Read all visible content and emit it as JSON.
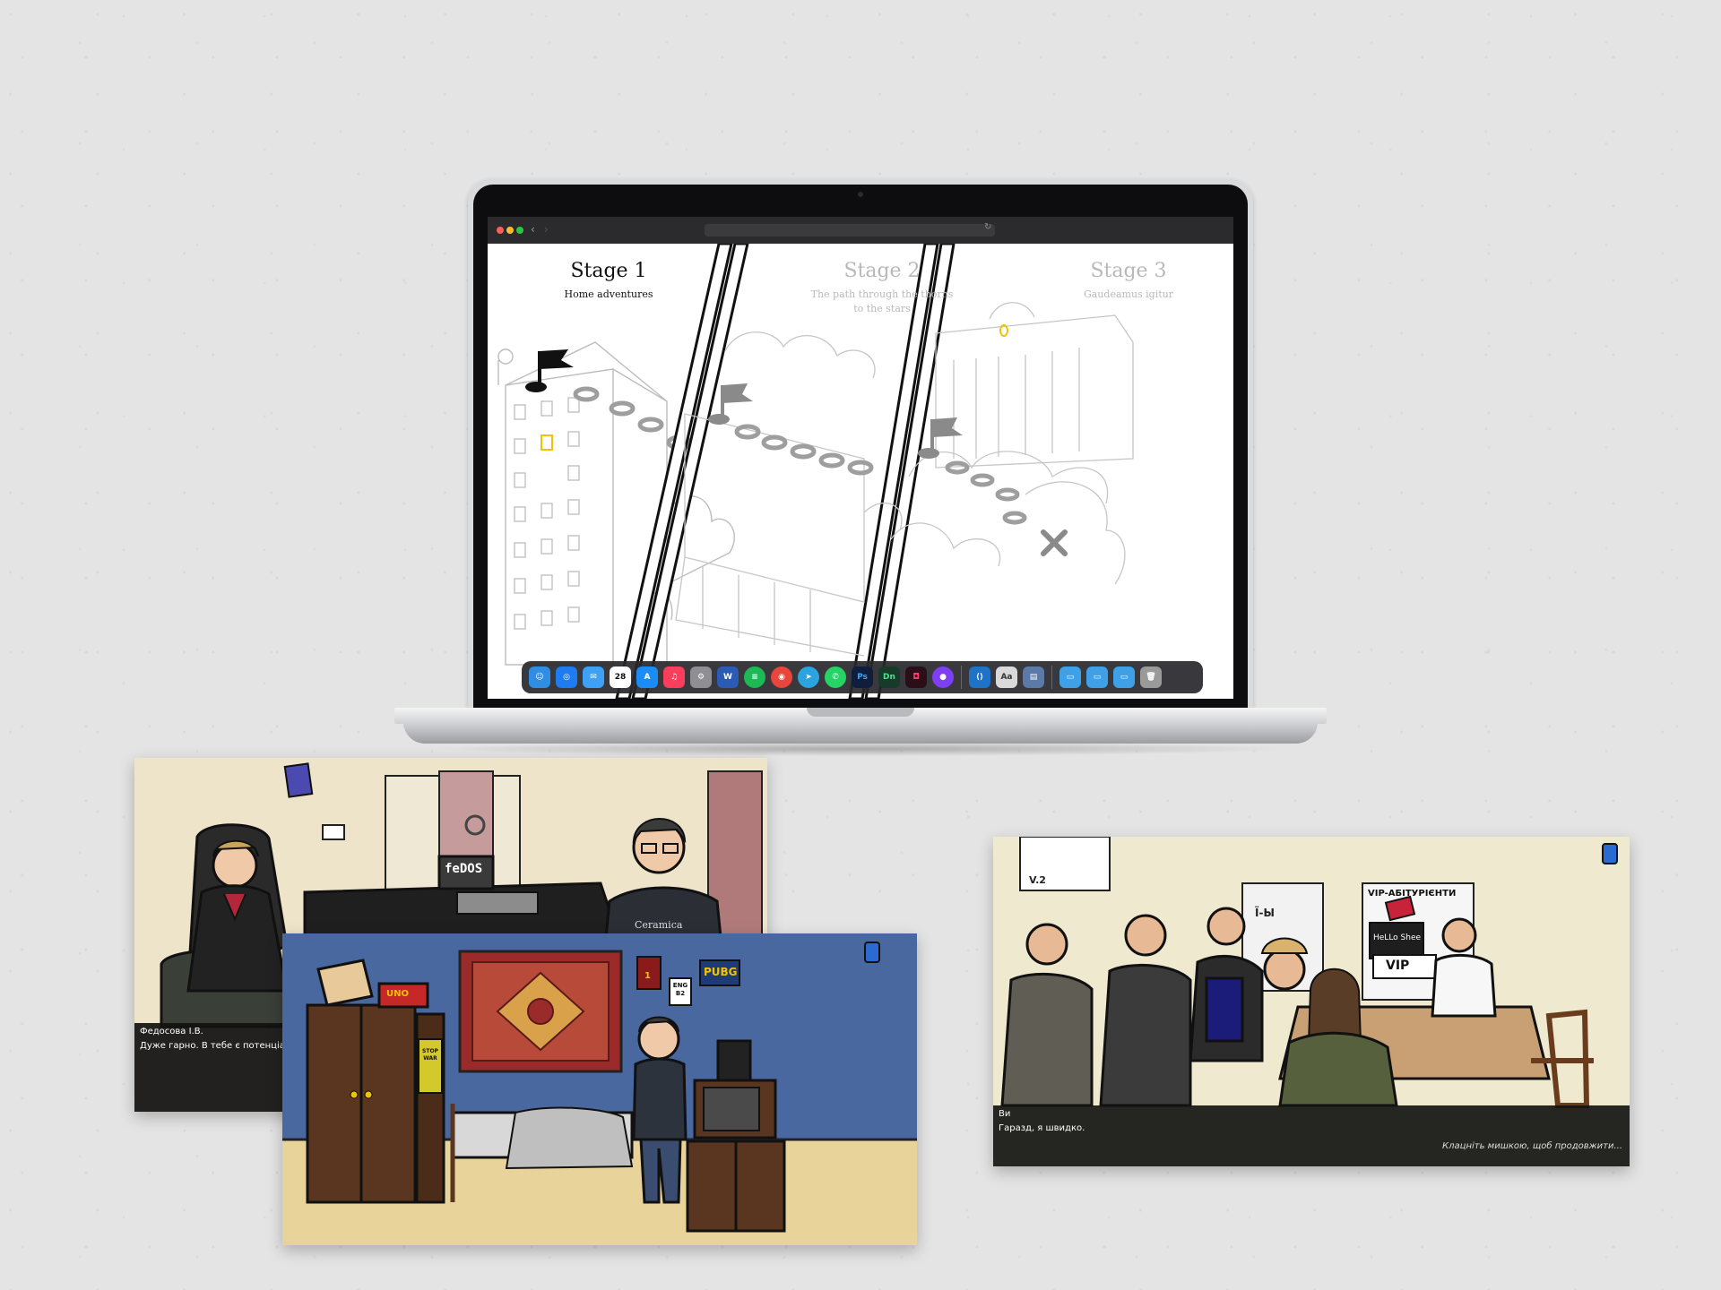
{
  "stages": [
    {
      "title": "Stage 1",
      "subtitle": "Home adventures"
    },
    {
      "title": "Stage 2",
      "subtitle": "The path through the thorns to the stars"
    },
    {
      "title": "Stage 3",
      "subtitle": "Gaudeamus igitur"
    }
  ],
  "dock": {
    "calendar_day": "28",
    "app_labels": {
      "word": "W",
      "photoshop": "Ps",
      "dimension": "Dn"
    }
  },
  "scenes": {
    "office": {
      "monitor_text": "feDOS",
      "shirt_text": "Ceramica",
      "speaker": "Федосова І.В.",
      "dialog": "Дуже гарно. В тебе є потенціал. Але"
    },
    "bedroom": {
      "uno_label": "UNO",
      "pubg_poster": "PUBG",
      "eng_poster": "ENG B2",
      "wanted_poster": "1",
      "cabinet_sticker": "STOP WAR"
    },
    "admissions": {
      "wall_sign": "V.2",
      "door_sign": "Ї-Ы",
      "vip_banner": "VIP-АБІТУРІЄНТИ",
      "badge_hello": "HeLLo Shee",
      "vip_sign": "VIP",
      "speaker": "Ви",
      "dialog": "Гаразд, я швидко.",
      "continue_hint": "Клацніть мишкою, щоб продовжити..."
    }
  },
  "colors": {
    "accent_yellow": "#f2c200",
    "rug_red": "#9b2a2a",
    "wall_blue": "#4a68a0"
  }
}
